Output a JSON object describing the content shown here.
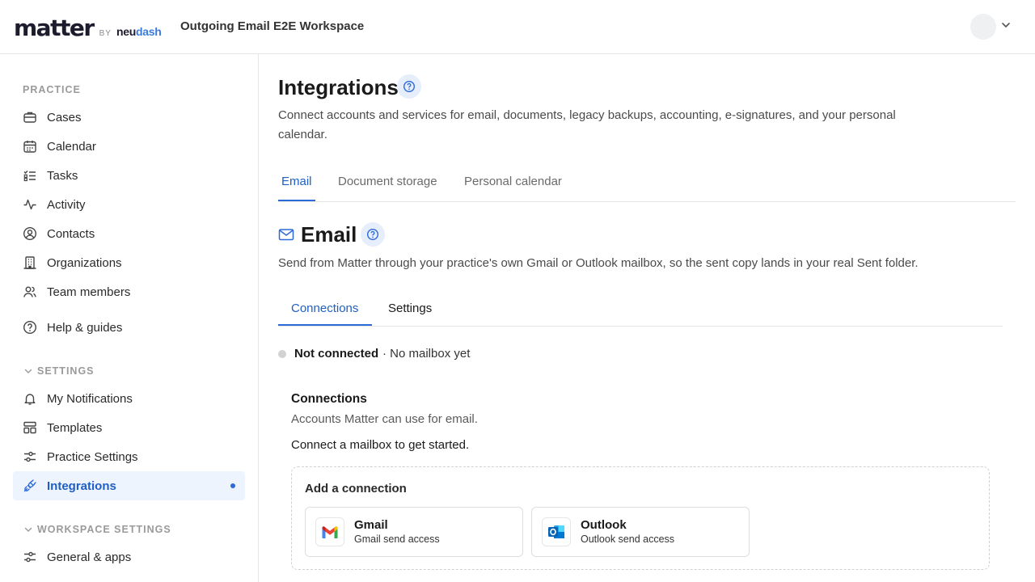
{
  "header": {
    "logo_main": "matter",
    "logo_by": "BY",
    "logo_neu": "neu",
    "logo_dash": "dash",
    "workspace": "Outgoing Email E2E Workspace"
  },
  "sidebar": {
    "practice_title": "PRACTICE",
    "practice_items": [
      {
        "label": "Cases",
        "icon": "briefcase-icon"
      },
      {
        "label": "Calendar",
        "icon": "calendar-icon"
      },
      {
        "label": "Tasks",
        "icon": "tasks-icon"
      },
      {
        "label": "Activity",
        "icon": "activity-icon"
      },
      {
        "label": "Contacts",
        "icon": "contact-icon"
      },
      {
        "label": "Organizations",
        "icon": "building-icon"
      },
      {
        "label": "Team members",
        "icon": "team-icon"
      }
    ],
    "help_label": "Help & guides",
    "settings_title": "SETTINGS",
    "settings_items": [
      {
        "label": "My Notifications",
        "icon": "bell-icon"
      },
      {
        "label": "Templates",
        "icon": "template-icon"
      },
      {
        "label": "Practice Settings",
        "icon": "sliders-icon"
      },
      {
        "label": "Integrations",
        "icon": "plug-icon",
        "active": true
      }
    ],
    "workspace_title": "WORKSPACE SETTINGS",
    "workspace_items": [
      {
        "label": "General & apps",
        "icon": "sliders-icon"
      }
    ]
  },
  "main": {
    "title": "Integrations",
    "description": "Connect accounts and services for email, documents, legacy backups, accounting, e-signatures, and your personal calendar.",
    "tabs": [
      "Email",
      "Document storage",
      "Personal calendar"
    ],
    "email_section": {
      "title": "Email",
      "description": "Send from Matter through your practice's own Gmail or Outlook mailbox, so the sent copy lands in your real Sent folder.",
      "tabs": [
        "Connections",
        "Settings"
      ],
      "status": "Not connected",
      "status_detail": "· No mailbox yet",
      "connections_title": "Connections",
      "connections_sub": "Accounts Matter can use for email.",
      "connections_cta": "Connect a mailbox to get started.",
      "add_title": "Add a connection",
      "providers": [
        {
          "name": "Gmail",
          "desc": "Gmail send access"
        },
        {
          "name": "Outlook",
          "desc": "Outlook send access"
        }
      ]
    }
  },
  "colors": {
    "accent": "#2d6ad8",
    "active_bg": "#eef4fe",
    "logo_accent": "#3a7be0"
  }
}
